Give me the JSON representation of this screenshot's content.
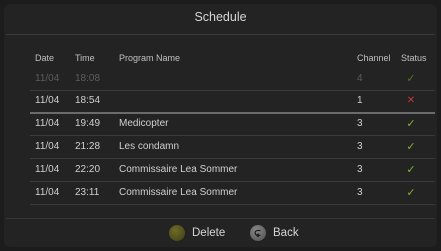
{
  "title": "Schedule",
  "columns": {
    "date": "Date",
    "time": "Time",
    "name": "Program Name",
    "channel": "Channel",
    "status": "Status"
  },
  "rows": [
    {
      "date": "11/04",
      "time": "18:08",
      "name": "",
      "channel": "4",
      "status": "ok",
      "status_glyph": "✓",
      "state": "dim"
    },
    {
      "date": "11/04",
      "time": "18:54",
      "name": "",
      "channel": "1",
      "status": "failed",
      "status_glyph": "✕",
      "state": "selected"
    },
    {
      "date": "11/04",
      "time": "19:49",
      "name": "Medicopter",
      "channel": "3",
      "status": "ok",
      "status_glyph": "✓",
      "state": "normal"
    },
    {
      "date": "11/04",
      "time": "21:28",
      "name": "Les condamn",
      "channel": "3",
      "status": "ok",
      "status_glyph": "✓",
      "state": "normal"
    },
    {
      "date": "11/04",
      "time": "22:20",
      "name": "Commissaire Lea Sommer",
      "channel": "3",
      "status": "ok",
      "status_glyph": "✓",
      "state": "normal"
    },
    {
      "date": "11/04",
      "time": "23:11",
      "name": "Commissaire Lea Sommer",
      "channel": "3",
      "status": "ok",
      "status_glyph": "✓",
      "state": "normal"
    }
  ],
  "footer": {
    "delete_label": "Delete",
    "back_label": "Back"
  },
  "colors": {
    "ok": "#7fb52e",
    "failed": "#c23a3a",
    "delete_button": "#5c5a22",
    "back_button": "#7a7a7a"
  },
  "icons": {
    "delete": "yellow-dot-icon",
    "back": "back-arrow-icon",
    "ok": "check-icon",
    "failed": "cross-icon"
  }
}
